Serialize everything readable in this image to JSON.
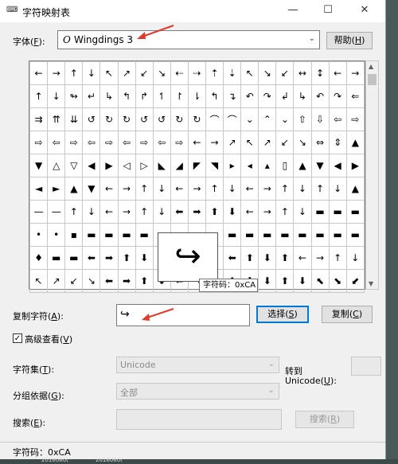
{
  "window": {
    "title": "字符映射表",
    "minimize_glyph": "—",
    "maximize_glyph": "☐",
    "close_glyph": "✕"
  },
  "font": {
    "label": "字体",
    "accel": "F",
    "label_suffix": "):",
    "selected": "Wingdings 3",
    "font_icon_glyph": "O"
  },
  "help_button": {
    "label": "帮助",
    "accel": "H"
  },
  "grid_rows": [
    [
      "←",
      "→",
      "↑",
      "↓",
      "↖",
      "↗",
      "↙",
      "↘",
      "⇠",
      "⇢",
      "⇡",
      "⇣",
      "↖",
      "↘",
      "↙",
      "↔",
      "↕",
      "←",
      "→"
    ],
    [
      "↑",
      "↓",
      "↬",
      "↵",
      "↳",
      "↰",
      "↱",
      "↿",
      "↾",
      "⇂",
      "↰",
      "↴",
      "↶",
      "↷",
      "↲",
      "↳",
      "↶",
      "↷",
      "⇐"
    ],
    [
      "⇉",
      "⇈",
      "⇊",
      "↺",
      "↻",
      "↻",
      "↺",
      "↺",
      "↻",
      "↻",
      "⌒",
      "⌒",
      "⌄",
      "⌃",
      "⌄",
      "⇧",
      "⇩",
      "⇦",
      "⇨"
    ],
    [
      "⇨",
      "⇦",
      "⇨",
      "⇦",
      "⇨",
      "⇦",
      "⇨",
      "⇦",
      "⇨",
      "←",
      "→",
      "↗",
      "↖",
      "↗",
      "↙",
      "↘",
      "⇔",
      "⇕",
      "▲"
    ],
    [
      "▼",
      "△",
      "▽",
      "◀",
      "▶",
      "◁",
      "▷",
      "◣",
      "◢",
      "◤",
      "◥",
      "▸",
      "◂",
      "▴",
      "▯",
      "▲",
      "▼",
      "◀",
      "▶"
    ],
    [
      "◄",
      "►",
      "▲",
      "▼",
      "←",
      "→",
      "↑",
      "↓",
      "←",
      "→",
      "↑",
      "↓",
      "←",
      "→",
      "↑",
      "↓",
      "↑",
      "↓",
      "▲"
    ],
    [
      "—",
      "—",
      "↑",
      "↓",
      "←",
      "→",
      "↑",
      "↓",
      "⬅",
      "➡",
      "⬆",
      "⬇",
      "←",
      "→",
      "↑",
      "↓",
      "▬",
      "▬",
      "▬"
    ],
    [
      "•",
      "•",
      "▪",
      "▬",
      "▬",
      "▬",
      "▬",
      "▬",
      "▬",
      "▬",
      "▬",
      "▬",
      "▬",
      "▬",
      "▬",
      "▬",
      "▬",
      "▬",
      "▬"
    ],
    [
      "♦",
      "▬",
      "▬",
      "⬅",
      "➡",
      "⬆",
      "⬇",
      "⬅",
      "➡",
      "⬆",
      "⬇",
      "⬅",
      "⬆",
      "⬇",
      "⬆",
      "←",
      "→",
      "↑",
      "↓"
    ],
    [
      "↖",
      "↗",
      "↙",
      "↘",
      "⬅",
      "➡",
      "⬆",
      "⬇",
      "⬅",
      "↪",
      "⬅",
      "⬆",
      "⬇",
      "⬇",
      "⬆",
      "⬇",
      "⬉",
      "⬊",
      "⬋"
    ]
  ],
  "zoom_glyph": "↪",
  "tooltip": "字符码：0xCA",
  "copy": {
    "label": "复制字符",
    "accel": "A",
    "label_suffix": "):",
    "value": "↪",
    "select_label": "选择",
    "select_accel": "S",
    "copy_label": "复制",
    "copy_accel": "C"
  },
  "advanced": {
    "label": "高级查看",
    "accel": "V",
    "checked": true,
    "check_glyph": "✓"
  },
  "charset": {
    "label": "字符集",
    "accel": "T",
    "label_suffix": "):",
    "value": "Unicode"
  },
  "group_by": {
    "label": "分组依据",
    "accel": "G",
    "label_suffix": "):",
    "value": "全部"
  },
  "goto_unicode": {
    "label_line1": "转到",
    "label_line2": "Unicode",
    "accel": "U",
    "label_suffix": "):"
  },
  "search": {
    "label": "搜索",
    "accel": "E",
    "label_suffix": "):",
    "button_label": "搜索",
    "button_accel": "R"
  },
  "status": {
    "text": "字符码：0xCA"
  },
  "taskbar_labels": [
    "2016060(",
    "2016060("
  ],
  "colors": {
    "arrow_annotation": "#e03a2e",
    "focus": "#0078d7"
  }
}
